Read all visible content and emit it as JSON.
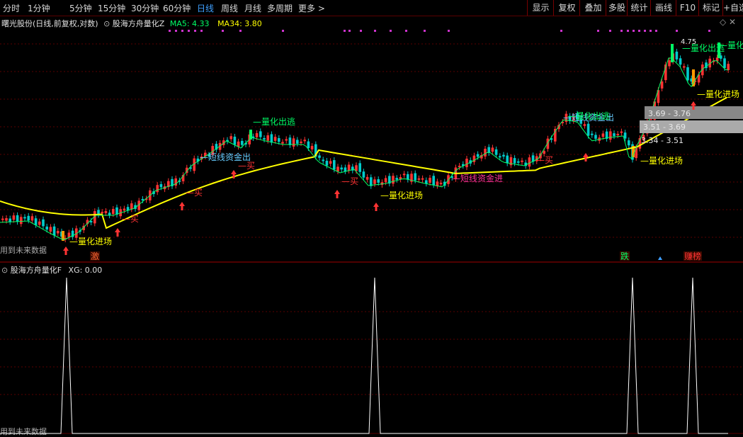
{
  "toolbar": {
    "periods": [
      "分时",
      "1分钟",
      "5分钟",
      "15分钟",
      "30分钟",
      "60分钟",
      "日线",
      "周线",
      "月线",
      "多周期",
      "更多 >"
    ],
    "active_period": "日线",
    "buttons": [
      "显示",
      "复权",
      "叠加",
      "多股",
      "统计",
      "画线",
      "F10",
      "标记",
      "+自选"
    ]
  },
  "main_panel": {
    "stock_title": "曙光股份(日线,前复权,对数)",
    "indicator_name": "股海方舟量化Z",
    "ma5_label": "MA5: 4.33",
    "ma34_label": "MA34: 3.80",
    "future_data_note": "用到未来数据",
    "price_high_label": "4.75",
    "zones": [
      {
        "text": "3.69 - 3.76"
      },
      {
        "text": "3.51 - 3.69"
      },
      {
        "text": "3.34 - 3.51"
      }
    ],
    "signals": [
      {
        "text": "量化进场",
        "color": "#ffff00"
      },
      {
        "text": "买",
        "color": "#ff3333"
      },
      {
        "text": "买",
        "color": "#ff3333"
      },
      {
        "text": "短线资金出",
        "color": "#66ccff"
      },
      {
        "text": "买",
        "color": "#ff3333"
      },
      {
        "text": "量化出逃",
        "color": "#00ff66"
      },
      {
        "text": "买",
        "color": "#ff3333"
      },
      {
        "text": "量化进场",
        "color": "#ffff00"
      },
      {
        "text": "短线资金进",
        "color": "#ff3399"
      },
      {
        "text": "买",
        "color": "#ff3333"
      },
      {
        "text": "短线资金出",
        "color": "#66ccff"
      },
      {
        "text": "量化出逃",
        "color": "#00ff66"
      },
      {
        "text": "量化进场",
        "color": "#ffff00"
      },
      {
        "text": "量化出逃",
        "color": "#00ff66"
      },
      {
        "text": "量化出逃",
        "color": "#00ff66"
      },
      {
        "text": "量化进场",
        "color": "#ffff00"
      }
    ],
    "bottom_tags": [
      {
        "text": "激",
        "color": "#ff6633"
      },
      {
        "text": "跌",
        "color": "#00ff66"
      },
      {
        "text": "赚榜",
        "color": "#ff3333"
      }
    ]
  },
  "sub_panel": {
    "indicator_name": "股海方舟量化F",
    "xg_label": "XG: 0.00",
    "future_data_note": "用到未来数据"
  },
  "colors": {
    "up": "#ff3333",
    "down": "#00cccc",
    "ma_long": "#ffff00",
    "ma_short": "#00ff66",
    "grid": "#5a0000"
  }
}
